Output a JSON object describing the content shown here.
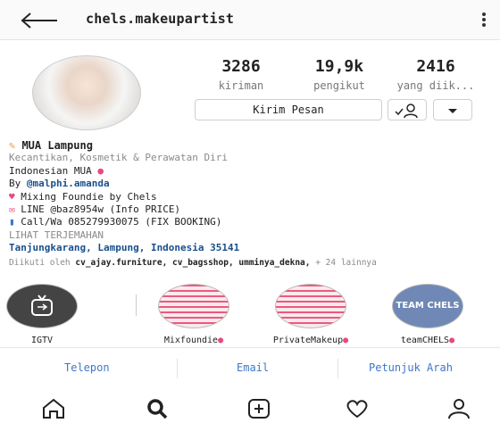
{
  "header": {
    "username": "chels.makeupartist"
  },
  "stats": [
    {
      "value": "3286",
      "label": "kiriman"
    },
    {
      "value": "19,9k",
      "label": "pengikut"
    },
    {
      "value": "2416",
      "label": "yang diik..."
    }
  ],
  "actions": {
    "message": "Kirim Pesan"
  },
  "bio": {
    "name": "MUA Lampung",
    "category": "Kecantikan, Kosmetik & Perawatan Diri",
    "line1": "Indonesian MUA",
    "by_prefix": "By",
    "by_handle": "@malphi.amanda",
    "line3": "Mixing Foundie by Chels",
    "line4": "LINE @baz8954w (Info PRICE)",
    "line5": "Call/Wa 085279930075 (FIX BOOKING)",
    "translate": "LIHAT TERJEMAHAN",
    "location": "Tanjungkarang, Lampung, Indonesia 35141",
    "followed_prefix": "Diikuti oleh",
    "followed_names": "cv_ajay.furniture, cv_bagsshop, umminya_dekna,",
    "followed_more": "+ 24 lainnya"
  },
  "highlights": [
    {
      "label": "IGTV"
    },
    {
      "label": "Mixfoundie"
    },
    {
      "label": "PrivateMakeup"
    },
    {
      "label": "teamCHELS",
      "cover_text": "TEAM CHELS"
    }
  ],
  "contact": {
    "phone": "Telepon",
    "email": "Email",
    "directions": "Petunjuk Arah"
  },
  "colors": {
    "link": "#3f78c7",
    "heart": "#e84a7a",
    "stripe": "#ea5a7c"
  }
}
